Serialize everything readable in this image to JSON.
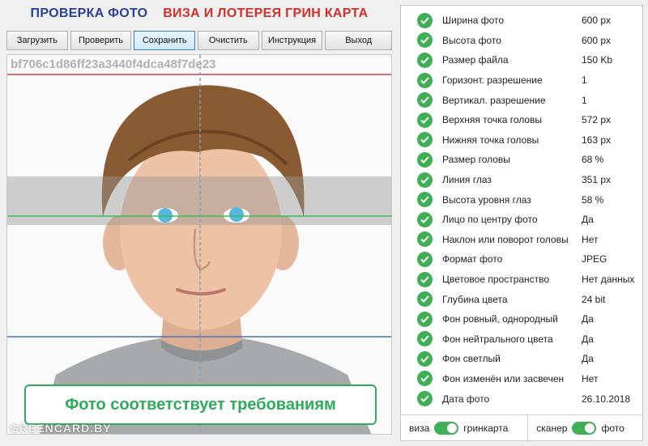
{
  "header": {
    "title_left": "ПРОВЕРКА ФОТО",
    "title_right": "ВИЗА И ЛОТЕРЕЯ ГРИН КАРТА"
  },
  "toolbar": {
    "buttons": [
      {
        "label": "Загрузить",
        "name": "load-button"
      },
      {
        "label": "Проверить",
        "name": "check-button"
      },
      {
        "label": "Сохранить",
        "name": "save-button",
        "active": true
      },
      {
        "label": "Очистить",
        "name": "clear-button"
      },
      {
        "label": "Инструкция",
        "name": "instruction-button"
      },
      {
        "label": "Выход",
        "name": "exit-button"
      }
    ]
  },
  "photo": {
    "id": "bf706c1d86ff23a3440f4dca48f7de23",
    "status": "Фото соответствует требованиям",
    "watermark": "GREENCARD.BY"
  },
  "params": [
    {
      "name": "Ширина фото",
      "value": "600 px"
    },
    {
      "name": "Высота фото",
      "value": "600 px"
    },
    {
      "name": "Размер файла",
      "value": "150 Kb"
    },
    {
      "name": "Горизонт. разрешение",
      "value": "1"
    },
    {
      "name": "Вертикал. разрешение",
      "value": "1"
    },
    {
      "name": "Верхняя точка головы",
      "value": "572 px"
    },
    {
      "name": "Нижняя точка головы",
      "value": "163 px"
    },
    {
      "name": "Размер головы",
      "value": "68 %"
    },
    {
      "name": "Линия глаз",
      "value": "351 px"
    },
    {
      "name": "Высота уровня глаз",
      "value": "58 %"
    },
    {
      "name": "Лицо по центру фото",
      "value": "Да"
    },
    {
      "name": "Наклон или поворот головы",
      "value": "Нет"
    },
    {
      "name": "Формат фото",
      "value": "JPEG"
    },
    {
      "name": "Цветовое пространство",
      "value": "Нет данных"
    },
    {
      "name": "Глубина цвета",
      "value": "24 bit"
    },
    {
      "name": "Фон ровный, однородный",
      "value": "Да"
    },
    {
      "name": "Фон нейтрального цвета",
      "value": "Да"
    },
    {
      "name": "Фон светлый",
      "value": "Да"
    },
    {
      "name": "Фон изменён или засвечен",
      "value": "Нет"
    },
    {
      "name": "Дата фото",
      "value": "26.10.2018"
    }
  ],
  "switches": {
    "left_off_label": "виза",
    "left_on_label": "гринкарта",
    "right_off_label": "сканер",
    "right_on_label": "фото"
  },
  "colors": {
    "ok_green": "#3fae55",
    "title_blue": "#2a3f9a",
    "title_red": "#d0302a"
  }
}
